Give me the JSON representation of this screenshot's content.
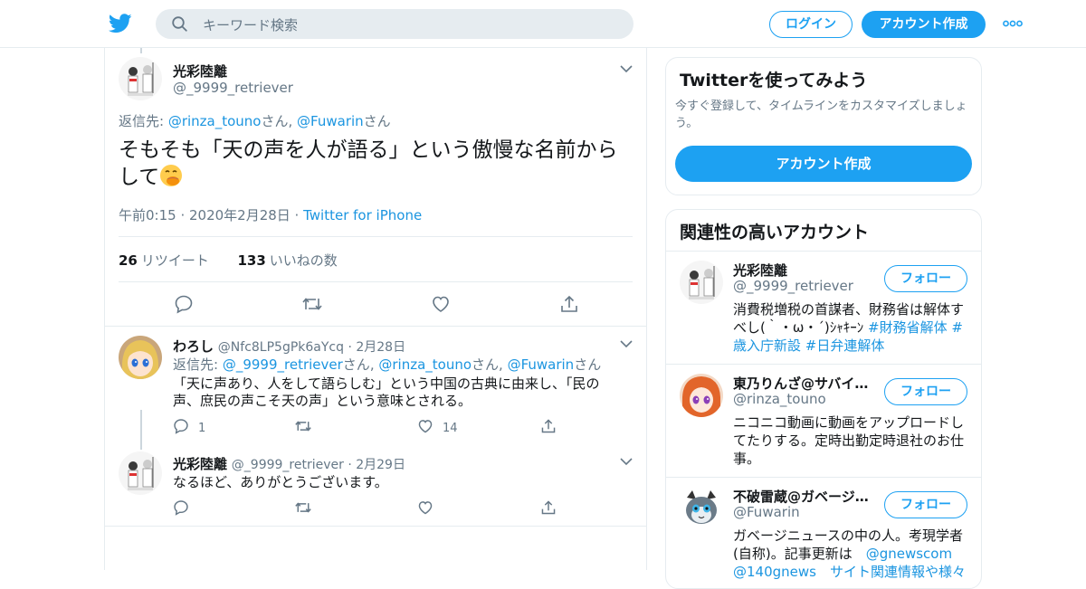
{
  "header": {
    "search_placeholder": "キーワード検索",
    "login_label": "ログイン",
    "signup_label": "アカウント作成"
  },
  "focus_tweet": {
    "name": "光彩陸離",
    "handle": "@_9999_retriever",
    "reply_prefix": "返信先: ",
    "reply_to": [
      "@rinza_touno",
      "@Fuwarin"
    ],
    "reply_suffix": "さん",
    "reply_sep": ", ",
    "text": "そもそも「天の声を人が語る」という傲慢な名前からして",
    "emoji_icon": "face-with-hand-over-mouth-emoji",
    "time": "午前0:15 · 2020年2月28日 · ",
    "source": "Twitter for iPhone",
    "retweets": "26",
    "retweets_label": "リツイート",
    "likes": "133",
    "likes_label": "いいねの数"
  },
  "replies": [
    {
      "name": "わろし",
      "handle": "@Nfc8LP5gPk6aYcq",
      "date": " · 2月28日",
      "reply_prefix": "返信先: ",
      "reply_to": [
        "@_9999_retriever",
        "@rinza_touno",
        "@Fuwarin"
      ],
      "text": "「天に声あり、人をして語らしむ」という中国の古典に由来し、「民の声、庶民の声こそ天の声」という意味とされる。",
      "replies_count": "1",
      "retweets_count": "",
      "likes_count": "14"
    },
    {
      "name": "光彩陸離",
      "handle": "@_9999_retriever",
      "date": " · 2月29日",
      "text": "なるほど、ありがとうございます。",
      "replies_count": "",
      "retweets_count": "",
      "likes_count": ""
    }
  ],
  "sidebar": {
    "try_title": "Twitterを使ってみよう",
    "try_desc": "今すぐ登録して、タイムラインをカスタマイズしましょう。",
    "try_button": "アカウント作成",
    "related_title": "関連性の高いアカウント",
    "follow_label": "フォロー",
    "accounts": [
      {
        "name": "光彩陸離",
        "handle": "@_9999_retriever",
        "bio_text": "消費税増税の首謀者、財務省は解体すべし(｀・ω・´)ｼｬｷｰﾝ ",
        "bio_tags": "#財務省解体 #歳入庁新設 #日弁連解体"
      },
      {
        "name": "東乃りんざ@サバイ…",
        "handle": "@rinza_touno",
        "bio_text": "ニコニコ動画に動画をアップロードしてたりする。定時出勤定時退社のお仕事。"
      },
      {
        "name": "不破雷蔵@ガベージ…",
        "handle": "@Fuwarin",
        "bio_text": "ガベージニュースの中の人。考現学者(自称)。記事更新は　",
        "bio_link1": "@gnewscom",
        "bio_line3": "@140gnews　サイト関連情報や様々"
      }
    ]
  },
  "colors": {
    "accent": "#1da1f2",
    "link": "#1b95e0",
    "muted": "#657786",
    "border": "#e6ecf0"
  }
}
